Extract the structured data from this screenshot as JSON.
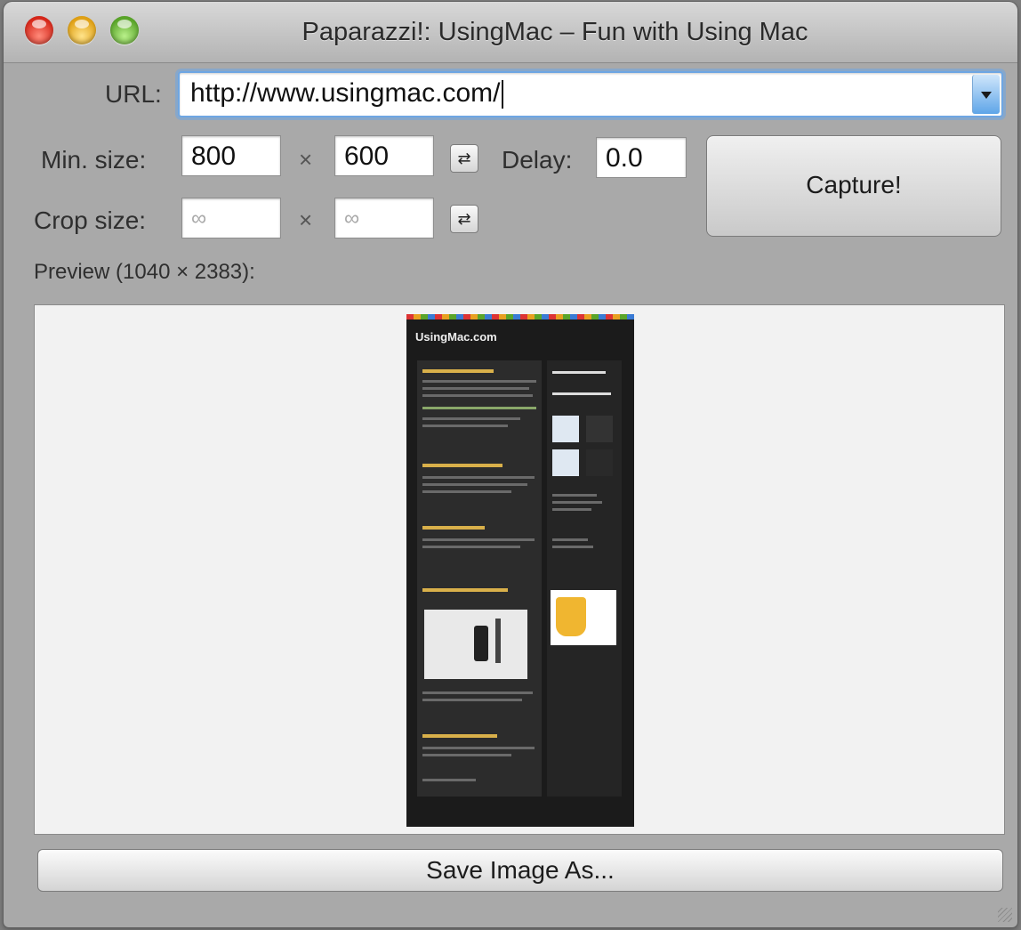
{
  "window": {
    "title": "Paparazzi!: UsingMac – Fun with Using Mac"
  },
  "url": {
    "label": "URL:",
    "value": "http://www.usingmac.com/"
  },
  "min_size": {
    "label": "Min. size:",
    "width": "800",
    "times": "×",
    "height": "600"
  },
  "delay": {
    "label": "Delay:",
    "value": "0.0"
  },
  "crop_size": {
    "label": "Crop size:",
    "width": "∞",
    "times": "×",
    "height": "∞"
  },
  "capture_label": "Capture!",
  "preview": {
    "label": "Preview (1040 × 2383):",
    "thumbnail_site_title": "UsingMac.com"
  },
  "save_label": "Save Image As...",
  "icons": {
    "swap": "swap-dimensions-icon",
    "dropdown": "chevron-down-icon"
  },
  "colors": {
    "focus_ring": "#6ea6e3",
    "window_bg": "#a9a9a9"
  }
}
